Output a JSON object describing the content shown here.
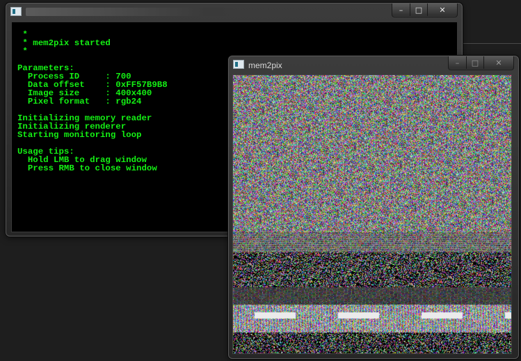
{
  "console": {
    "title": "",
    "lines": [
      " *",
      " * mem2pix started",
      " *",
      "",
      "Parameters:",
      "  Process ID     : 700",
      "  Data offset    : 0xFF57B9B8",
      "  Image size     : 400x400",
      "  Pixel format   : rgb24",
      "",
      "Initializing memory reader",
      "Initializing renderer",
      "Starting monitoring loop",
      "",
      "Usage tips:",
      "  Hold LMB to drag window",
      "  Press RMB to close window"
    ],
    "text_color": "#14f014",
    "background_color": "#000000"
  },
  "viewer": {
    "title": "mem2pix"
  },
  "caption_buttons": {
    "minimize": "–",
    "maximize": "□",
    "close": "✕"
  },
  "icons": {
    "app": "console-app-icon"
  }
}
